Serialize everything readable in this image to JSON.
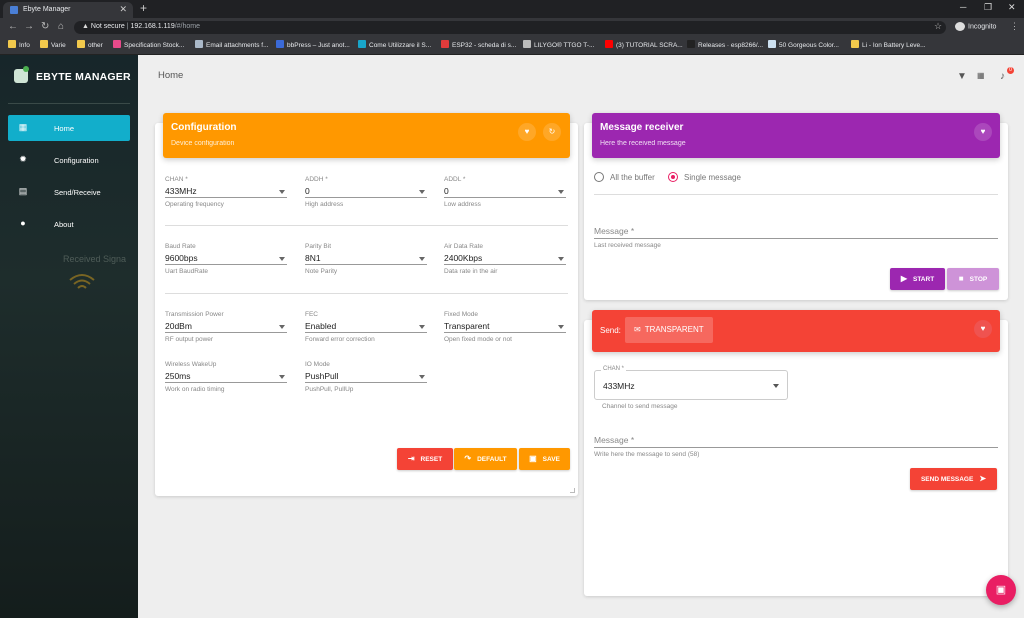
{
  "browser": {
    "tab_title": "Ebyte Manager",
    "new_tab": "+",
    "security": "Not secure",
    "url_host": "192.168.1.119",
    "url_path": "/#/home",
    "profile": "Incognito",
    "bookmarks": [
      {
        "label": "Info",
        "color": "#f2c94c"
      },
      {
        "label": "Varie",
        "color": "#f2c94c"
      },
      {
        "label": "other",
        "color": "#f2c94c"
      },
      {
        "label": "Specification Stock...",
        "color": "#e84a8a"
      },
      {
        "label": "Email attachments f...",
        "color": "#aab8c8"
      },
      {
        "label": "bbPress – Just anot...",
        "color": "#3b6ad8"
      },
      {
        "label": "Come Utilizzare il S...",
        "color": "#18a5c9"
      },
      {
        "label": "ESP32 - scheda di s...",
        "color": "#e23b3b"
      },
      {
        "label": "LILYGO® TTGO T-...",
        "color": "#bbbbbb"
      },
      {
        "label": "(3) TUTORIAL SCRA...",
        "color": "#ff0000"
      },
      {
        "label": "Releases · esp8266/...",
        "color": "#222222"
      },
      {
        "label": "50 Gorgeous Color...",
        "color": "#cce0f0"
      },
      {
        "label": "Li - Ion Battery Leve...",
        "color": "#f2c94c"
      }
    ]
  },
  "sidebar": {
    "brand": "EBYTE MANAGER",
    "items": [
      {
        "label": "Home",
        "icon": "dashboard-icon",
        "active": true
      },
      {
        "label": "Configuration",
        "icon": "gear-icon",
        "active": false
      },
      {
        "label": "Send/Receive",
        "icon": "chat-icon",
        "active": false
      },
      {
        "label": "About",
        "icon": "person-icon",
        "active": false
      }
    ],
    "background_text": "Received Signa"
  },
  "topbar": {
    "title": "Home",
    "notification_count": "0"
  },
  "config": {
    "title": "Configuration",
    "subtitle": "Device configuration",
    "fields": [
      {
        "label": "CHAN *",
        "value": "433MHz",
        "hint": "Operating frequency"
      },
      {
        "label": "ADDH *",
        "value": "0",
        "hint": "High address"
      },
      {
        "label": "ADDL *",
        "value": "0",
        "hint": "Low address"
      },
      {
        "label": "Baud Rate",
        "value": "9600bps",
        "hint": "Uart BaudRate"
      },
      {
        "label": "Parity Bit",
        "value": "8N1",
        "hint": "Note Parity"
      },
      {
        "label": "Air Data Rate",
        "value": "2400Kbps",
        "hint": "Data rate in the air"
      },
      {
        "label": "Transmission Power",
        "value": "20dBm",
        "hint": "RF output power"
      },
      {
        "label": "FEC",
        "value": "Enabled",
        "hint": "Forward error correction"
      },
      {
        "label": "Fixed Mode",
        "value": "Transparent",
        "hint": "Open fixed mode or not"
      },
      {
        "label": "Wireless WakeUp",
        "value": "250ms",
        "hint": "Work on radio timing"
      },
      {
        "label": "IO Mode",
        "value": "PushPull",
        "hint": "PushPull, PullUp"
      }
    ],
    "buttons": {
      "reset": "RESET",
      "default": "DEFAULT",
      "save": "SAVE"
    }
  },
  "receiver": {
    "title": "Message receiver",
    "subtitle": "Here the received message",
    "radio_all": "All the buffer",
    "radio_single": "Single message",
    "selected": "Single message",
    "message_label": "Message *",
    "message_hint": "Last received message",
    "start": "START",
    "stop": "STOP"
  },
  "sender": {
    "title": "Send:",
    "mode": "TRANSPARENT",
    "chan_label": "CHAN *",
    "chan_value": "433MHz",
    "chan_hint": "Channel to send message",
    "message_label": "Message *",
    "message_hint": "Write here the message to send (58)",
    "send_button": "SEND MESSAGE"
  },
  "colors": {
    "accent_cyan": "#12aecb",
    "config_orange": "#ff9800",
    "receiver_purple": "#9c27b0",
    "sender_red": "#f44336",
    "pink": "#e91e63"
  }
}
